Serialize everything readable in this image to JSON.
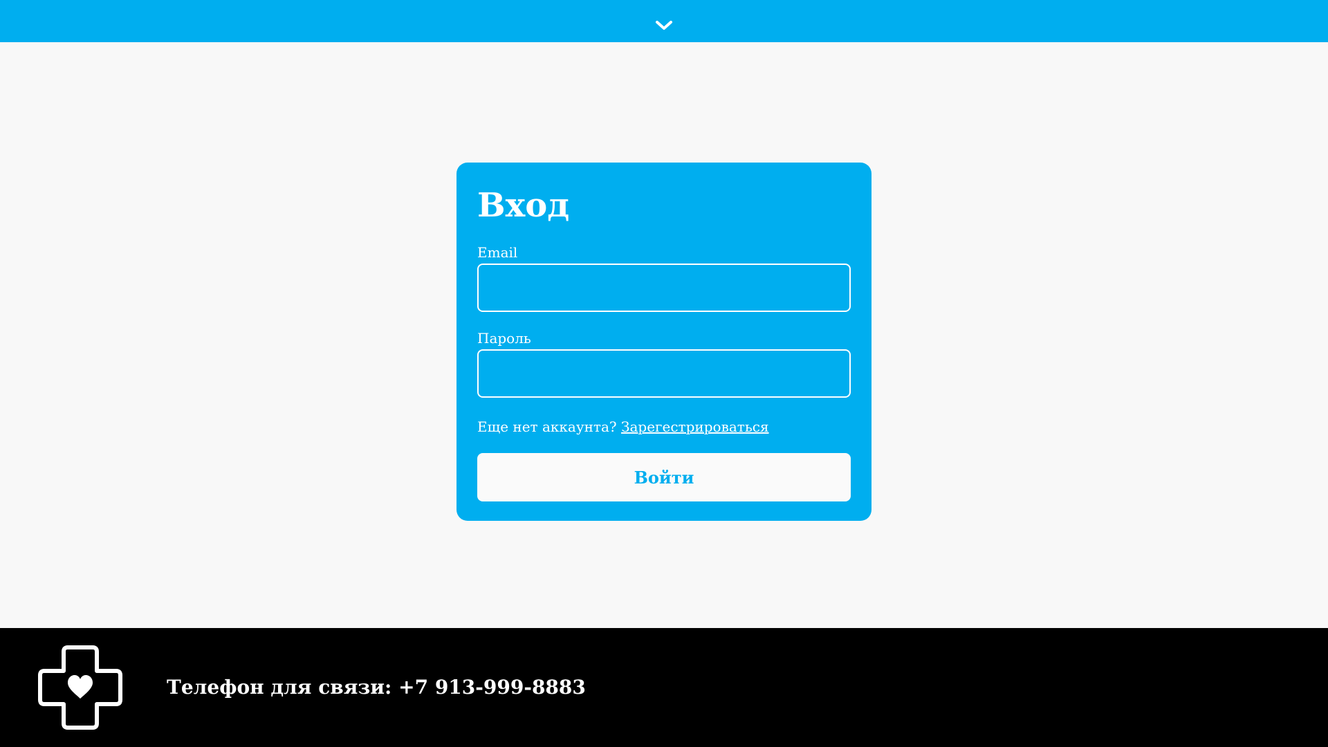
{
  "header": {
    "toggle_icon": "chevron-down-icon"
  },
  "login": {
    "title": "Вход",
    "email_label": "Email",
    "email_value": "",
    "password_label": "Пароль",
    "password_value": "",
    "no_account_text": "Еще нет аккаунта?",
    "register_link": "Зарегестрироваться",
    "submit_label": "Войти"
  },
  "footer": {
    "logo_icon": "medical-cross-heart-icon",
    "phone_text": "Телефон для связи: +7 913-999-8883"
  },
  "colors": {
    "accent": "#00aeef",
    "page_background": "#f8f8f8",
    "footer_background": "#000000",
    "button_background": "#fafafa"
  }
}
